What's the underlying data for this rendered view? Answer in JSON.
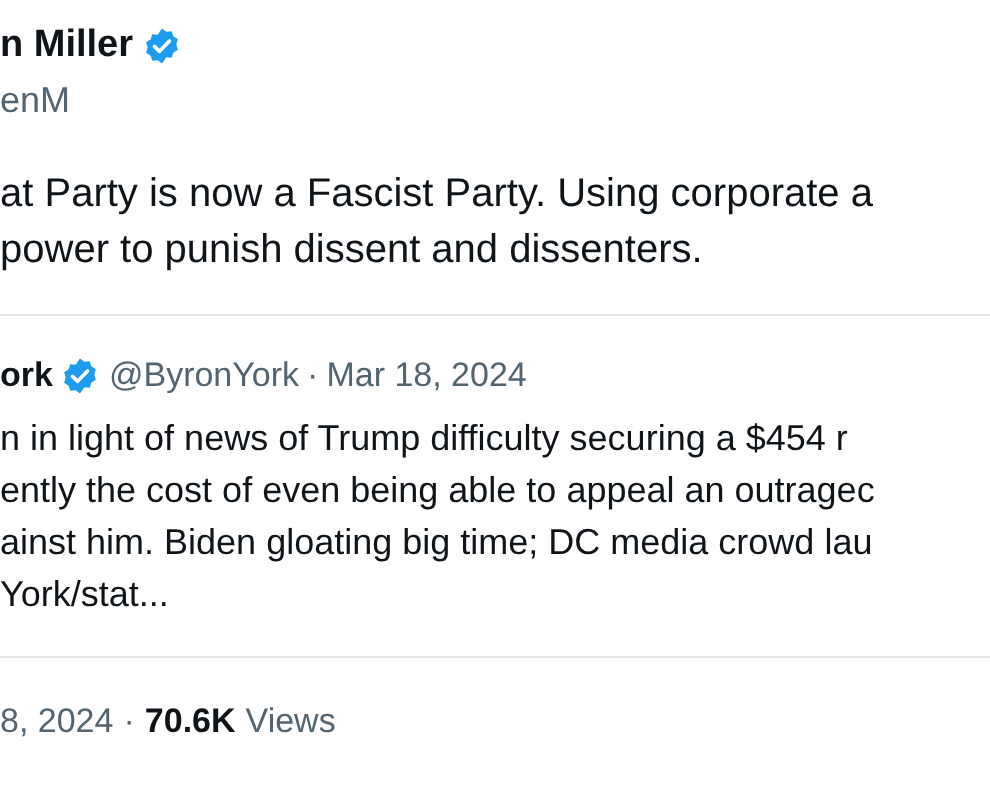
{
  "author": {
    "name": "n Miller",
    "verified": true,
    "handle": "enM"
  },
  "text_lines": [
    "at Party is now a Fascist Party. Using corporate a",
    "power to punish dissent and dissenters."
  ],
  "quoted": {
    "name": "ork",
    "verified": true,
    "handle": "@ByronYork",
    "separator": "·",
    "date": "Mar 18, 2024",
    "text_lines": [
      "n in light of news of Trump difficulty securing a $454 r",
      "ently the cost of even being able to appeal an outragec",
      "ainst him. Biden gloating big time; DC media crowd lau",
      "York/stat..."
    ]
  },
  "footer": {
    "date": "8, 2024",
    "separator": "·",
    "views_count": "70.6K",
    "views_label": "Views"
  }
}
